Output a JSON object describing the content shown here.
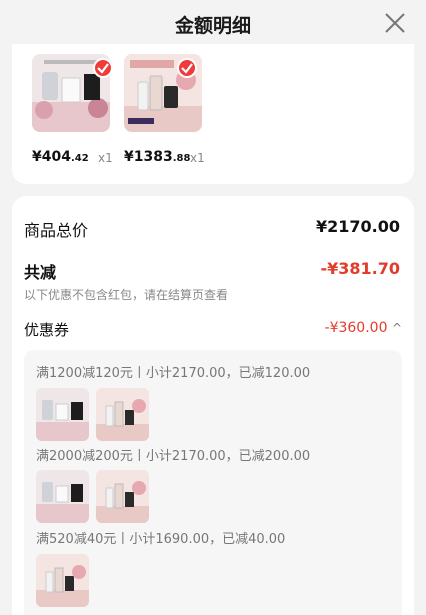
{
  "header": {
    "title": "金额明细"
  },
  "products": [
    {
      "name": "product-a",
      "price_main": "¥404",
      "price_small": ".42",
      "qty": "x1"
    },
    {
      "name": "product-b",
      "price_main": "¥1383",
      "price_small": ".88",
      "qty": "x1"
    }
  ],
  "summary": {
    "total_label": "商品总价",
    "total_value": "¥2170.00",
    "discount_label": "共减",
    "discount_value": "-¥381.70",
    "note": "以下优惠不包含红包，请在结算页查看",
    "coupon_label": "优惠券",
    "coupon_value": "-¥360.00",
    "coupon_chevron": "^"
  },
  "coupon_rules": [
    {
      "text": "满1200减120元丨小计2170.00，已减120.00"
    },
    {
      "text": "满2000减200元丨小计2170.00，已减200.00"
    },
    {
      "text": "满520减40元丨小计1690.00，已减40.00"
    }
  ],
  "colors": {
    "accent": "#e23c2c",
    "check": "#ef3b3b"
  },
  "icons": {
    "close": "close-icon",
    "check": "checkmark-icon",
    "chevron": "chevron-up-icon"
  }
}
